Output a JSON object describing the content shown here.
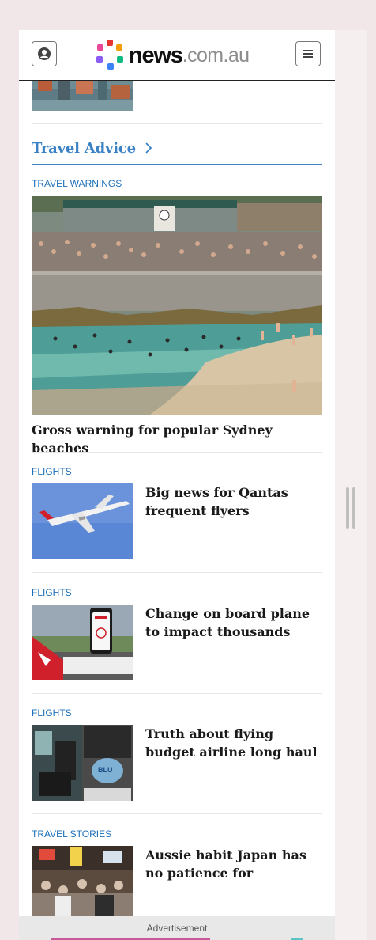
{
  "header": {
    "logo_bold": "news",
    "logo_light": ".com.au",
    "account_icon": "account-icon",
    "menu_icon": "hamburger-menu-icon"
  },
  "section": {
    "title": "Travel Advice",
    "chevron_icon": "chevron-right-icon"
  },
  "featured": {
    "category": "TRAVEL WARNINGS",
    "headline": "Gross warning for popular Sydney beaches"
  },
  "articles": [
    {
      "category": "FLIGHTS",
      "headline": "Big news for Qantas frequent flyers"
    },
    {
      "category": "FLIGHTS",
      "headline": "Change on board plane to impact thousands"
    },
    {
      "category": "FLIGHTS",
      "headline": "Truth about flying budget airline long haul"
    },
    {
      "category": "TRAVEL STORIES",
      "headline": "Aussie habit Japan has no patience for"
    }
  ],
  "ad": {
    "label": "Advertisement"
  },
  "colors": {
    "accent": "#1d6fb8",
    "section_title": "#3b82c4",
    "page_background": "#f1e6e8",
    "logo_dot_colors": [
      "#e3342f",
      "#f59e0b",
      "#10b981",
      "#3b82f6",
      "#8b5cf6",
      "#ec4899"
    ]
  }
}
